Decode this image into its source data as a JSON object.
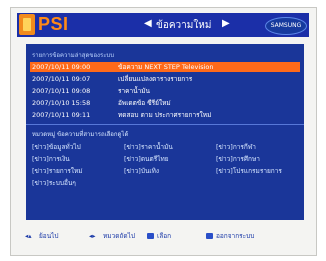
{
  "header": {
    "logo_text": "PSI",
    "nav_left_arrow": "◀",
    "nav_title": "ข้อความใหม่",
    "nav_right_arrow": "▶",
    "brand": "SAMSUNG"
  },
  "messages": {
    "section_title": "รายการข้อความล่าสุดของระบบ",
    "rows": [
      {
        "datetime": "2007/10/11 09:00",
        "text": "ข้อความ NEXT STEP Television"
      },
      {
        "datetime": "2007/10/11 09:07",
        "text": "เปลี่ยนแปลงตารางรายการ"
      },
      {
        "datetime": "2007/10/11 09:08",
        "text": "ราคาน้ำมัน"
      },
      {
        "datetime": "2007/10/10 15:58",
        "text": "อัพเดตข้อ ซีรีย์ใหม่"
      },
      {
        "datetime": "2007/10/11 09:11",
        "text": "ทดสอบ ตาม ประกาศรายการใหม่"
      }
    ]
  },
  "categories": {
    "section_title": "หมวดหมู่ ข้อความที่สามารถเลือกดูได้",
    "items": [
      "[ข่าว]ข้อมูลทั่วไป",
      "[ข่าว]ราคาน้ำมัน",
      "[ข่าว]การกีฬา",
      "[ข่าว]การเงิน",
      "[ข่าว]ดนตรีไทย",
      "[ข่าว]การศึกษา",
      "[ข่าว]รายการใหม่",
      "[ข่าว]บันเทิง",
      "[ข่าว]โปรแกรมรายการ",
      "[ข่าว]ระบบอื่นๆ"
    ]
  },
  "footer": {
    "back_label": "ย้อนไป",
    "page_label": "หมวดถัดไป",
    "select_label": "เลือก",
    "exit_label": "ออกจากระบบ"
  }
}
